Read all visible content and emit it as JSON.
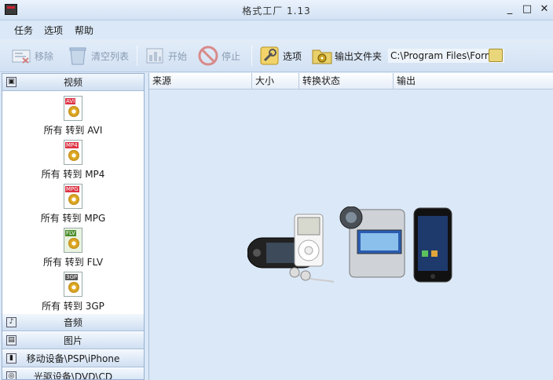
{
  "window": {
    "title": "格式工厂  1.13",
    "controls": {
      "minimize": "_",
      "maximize": "□",
      "close": "✕"
    }
  },
  "menu": [
    "任务",
    "选项",
    "帮助"
  ],
  "toolbar": {
    "remove_label": "移除",
    "clear_label": "清空列表",
    "start_label": "开始",
    "stop_label": "停止",
    "options_label": "选项",
    "output_folder_label": "输出文件夹",
    "output_path": "C:\\Program Files\\Form."
  },
  "sidebar": {
    "video_category": "视频",
    "conversions": [
      {
        "tag": "AVI",
        "label": "所有 转到 AVI"
      },
      {
        "tag": "MP4",
        "label": "所有 转到 MP4"
      },
      {
        "tag": "MPG",
        "label": "所有 转到 MPG"
      },
      {
        "tag": "FLV",
        "label": "所有 转到 FLV"
      },
      {
        "tag": "3GP",
        "label": "所有 转到 3GP"
      }
    ],
    "audio_category": "音频",
    "picture_category": "图片",
    "mobile_category": "移动设备\\PSP\\iPhone",
    "disc_category": "光驱设备\\DVD\\CD"
  },
  "filelist": {
    "columns": [
      "来源",
      "大小",
      "转换状态",
      "输出"
    ]
  },
  "colors": {
    "background": "#dbe8f7",
    "accent": "#c23a2a"
  }
}
